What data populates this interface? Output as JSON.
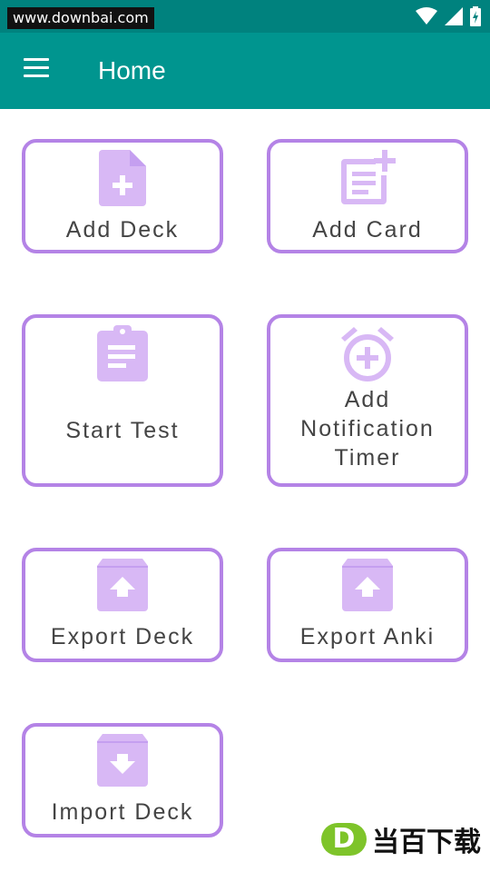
{
  "status_bar": {
    "watermark": "www.downbai.com"
  },
  "app_bar": {
    "title": "Home"
  },
  "tiles": [
    {
      "label": "Add Deck",
      "icon": "add-file-icon"
    },
    {
      "label": "Add Card",
      "icon": "add-note-icon"
    },
    {
      "label": "Start Test",
      "icon": "clipboard-icon"
    },
    {
      "label": "Add Notification Timer",
      "icon": "alarm-add-icon"
    },
    {
      "label": "Export Deck",
      "icon": "archive-up-icon"
    },
    {
      "label": "Export Anki",
      "icon": "archive-up-icon"
    },
    {
      "label": "Import Deck",
      "icon": "archive-down-icon"
    }
  ],
  "watermark_brand": {
    "letter": "D",
    "text": "当百下载"
  },
  "colors": {
    "teal": "#00958f",
    "accent": "#b483e6",
    "icon": "#d8b8f5"
  }
}
